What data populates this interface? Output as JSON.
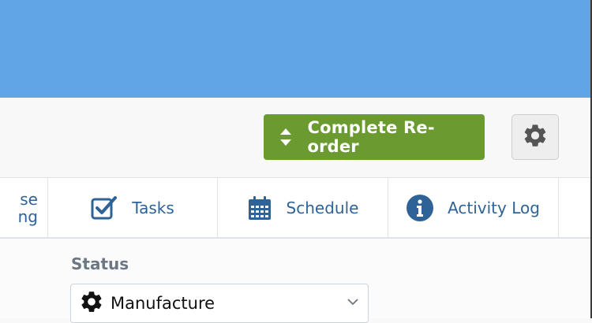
{
  "header": {
    "bar_color": "#62a5e7"
  },
  "toolbar": {
    "reorder_label": "Complete Re-order",
    "reorder_icon": "sort-arrows-icon",
    "reorder_color": "#6a9a30",
    "settings_icon": "gear-icon"
  },
  "tabs": [
    {
      "label": "se\nng",
      "icon": "",
      "partial": true
    },
    {
      "label": "Tasks",
      "icon": "checkbox-icon"
    },
    {
      "label": "Schedule",
      "icon": "calendar-icon"
    },
    {
      "label": "Activity Log",
      "icon": "info-circle-icon"
    }
  ],
  "status": {
    "label": "Status",
    "value": "Manufacture",
    "icon": "gear-icon"
  },
  "colors": {
    "link": "#2f6296",
    "border": "#dfe3e8"
  }
}
